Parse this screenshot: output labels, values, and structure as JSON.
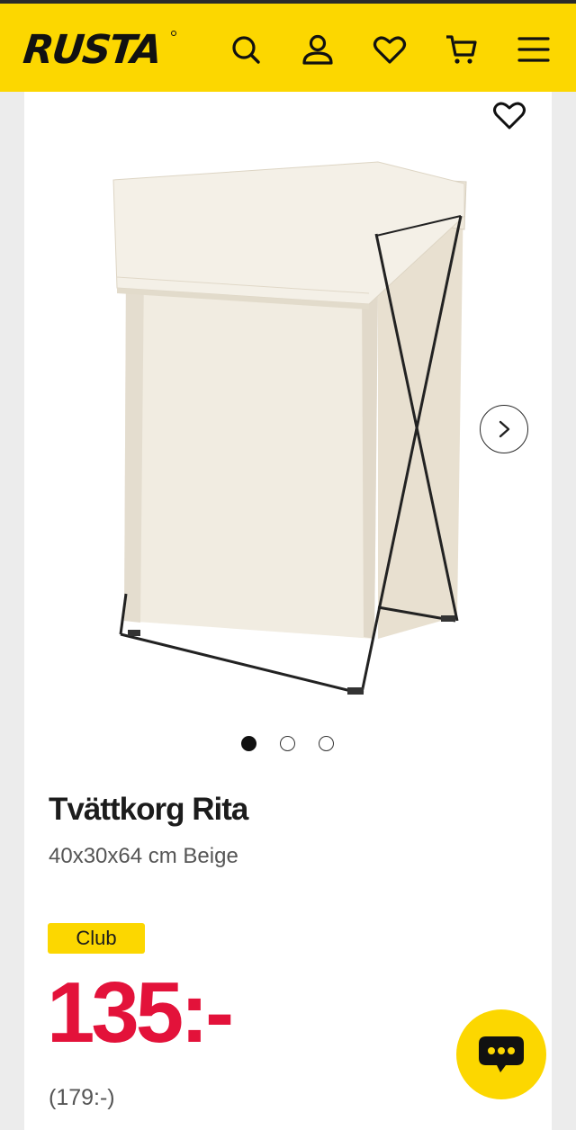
{
  "header": {
    "logo": "RUSTA",
    "icons": [
      "search-icon",
      "account-icon",
      "wishlist-heart-icon",
      "cart-icon",
      "menu-icon"
    ],
    "brand_color": "#fcd700"
  },
  "product": {
    "title": "Tvättkorg Rita",
    "subtitle": "40x30x64 cm Beige",
    "badge": "Club",
    "price": "135:-",
    "original_price": "(179:-)",
    "price_color": "#e3123a"
  },
  "gallery": {
    "total_images": 3,
    "active_index": 0
  }
}
